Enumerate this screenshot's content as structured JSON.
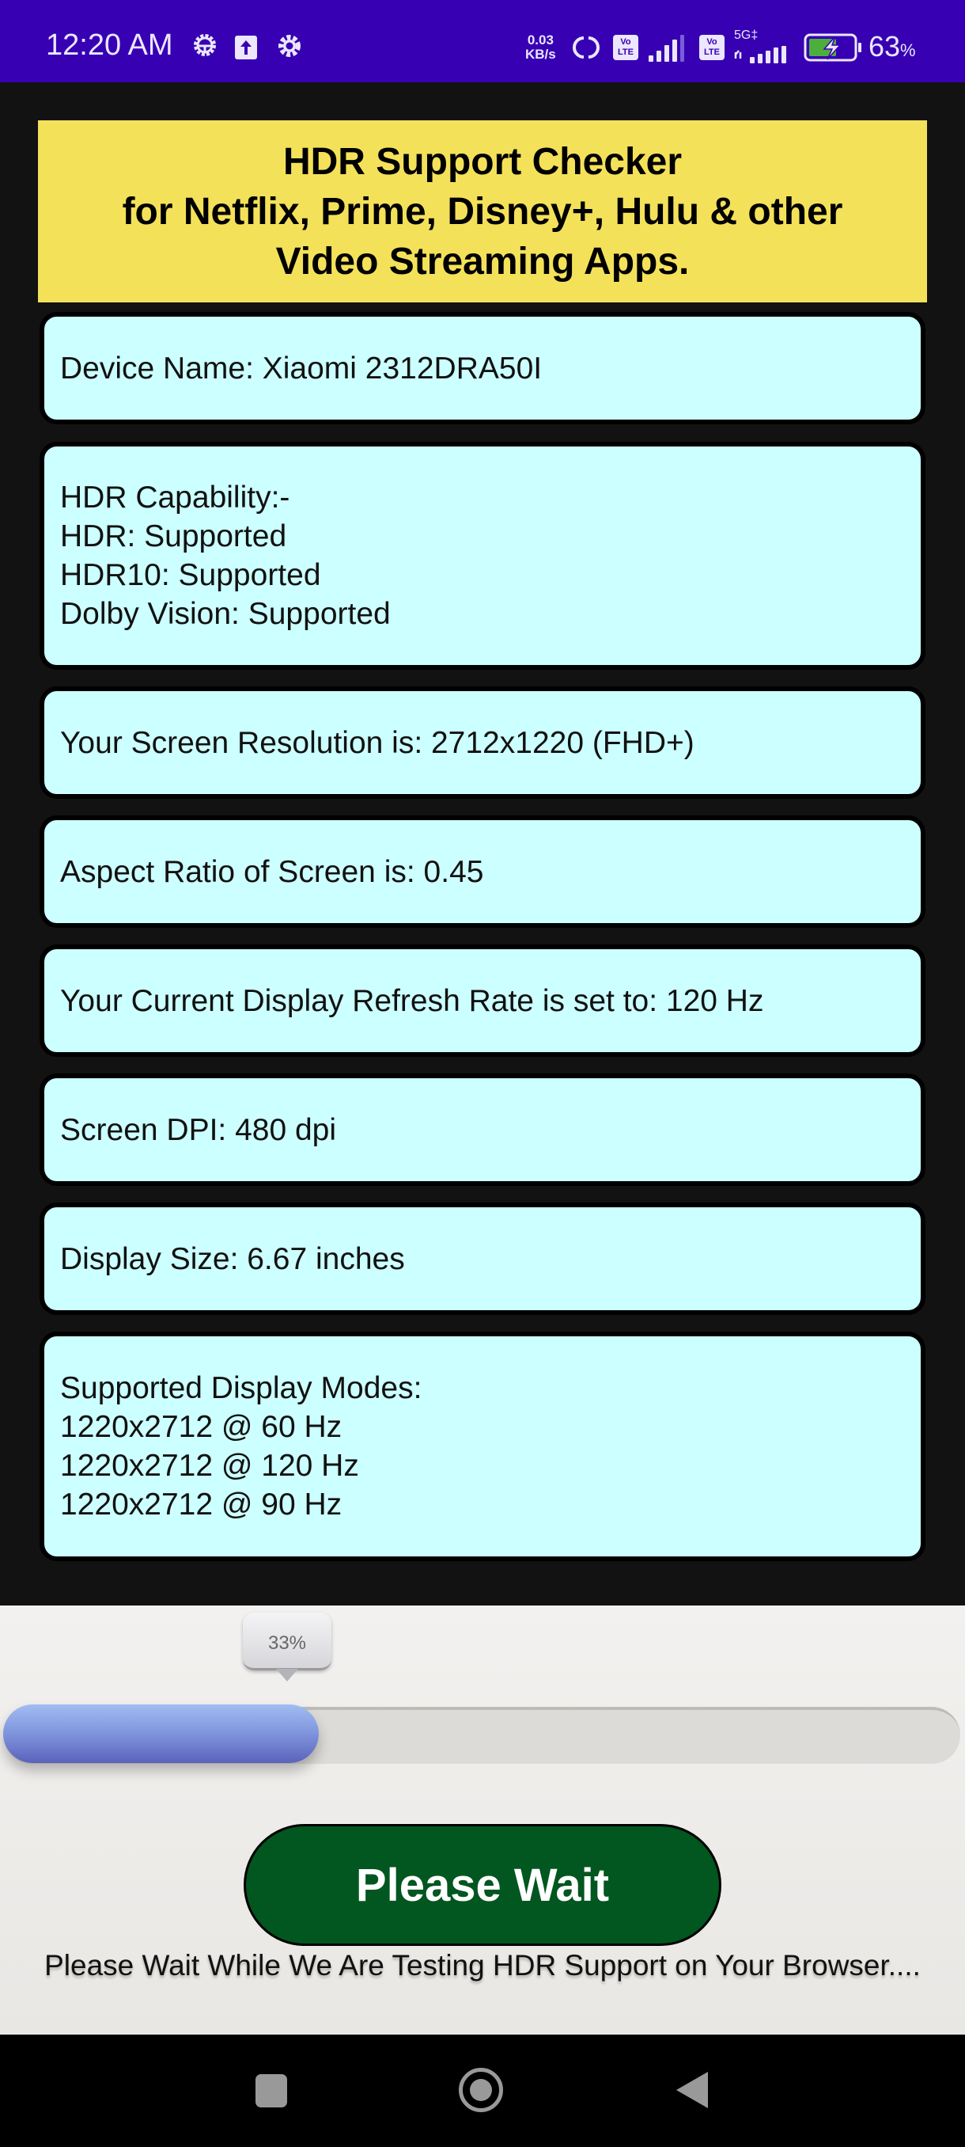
{
  "status_bar": {
    "time": "12:20 AM",
    "left_icons": [
      "bug-report-gear-icon",
      "upload-icon",
      "settings-gear-icon"
    ],
    "net_speed_value": "0.03",
    "net_speed_unit": "KB/s",
    "volte_label_top": "Vo",
    "volte_label_bottom": "LTE",
    "network_type": "5G‡",
    "battery_percent": "63",
    "battery_percent_sign": "%",
    "battery_level": 0.63,
    "battery_charging": true,
    "battery_fill_color": "#4caf3c"
  },
  "header": {
    "lines": [
      "HDR Support Checker",
      "for Netflix, Prime, Disney+, Hulu & other",
      "Video Streaming Apps."
    ],
    "background": "#f4e15a"
  },
  "cards": [
    {
      "lines": [
        "Device Name: Xiaomi 2312DRA50I"
      ]
    },
    {
      "lines": [
        "HDR Capability:-",
        "HDR: Supported",
        "HDR10: Supported",
        "Dolby Vision: Supported"
      ]
    },
    {
      "lines": [
        "Your Screen Resolution is: 2712x1220 (FHD+)"
      ]
    },
    {
      "lines": [
        "Aspect Ratio of Screen is: 0.45"
      ]
    },
    {
      "lines": [
        "Your Current Display Refresh Rate is set to: 120 Hz"
      ]
    },
    {
      "lines": [
        "Screen DPI: 480 dpi"
      ]
    },
    {
      "lines": [
        "Display Size: 6.67 inches"
      ]
    },
    {
      "lines": [
        "Supported Display Modes:",
        "1220x2712 @ 60 Hz",
        "1220x2712 @ 120 Hz",
        "1220x2712 @ 90 Hz"
      ]
    }
  ],
  "card_background": "#ccffff",
  "progress": {
    "value_percent": 33,
    "label": "33%"
  },
  "action": {
    "button_label": "Please Wait",
    "button_color": "#02561f",
    "message": "Please Wait While We Are Testing HDR Support on Your Browser...."
  },
  "nav_bar": {
    "buttons": [
      "recents-icon",
      "home-icon",
      "back-icon"
    ]
  }
}
